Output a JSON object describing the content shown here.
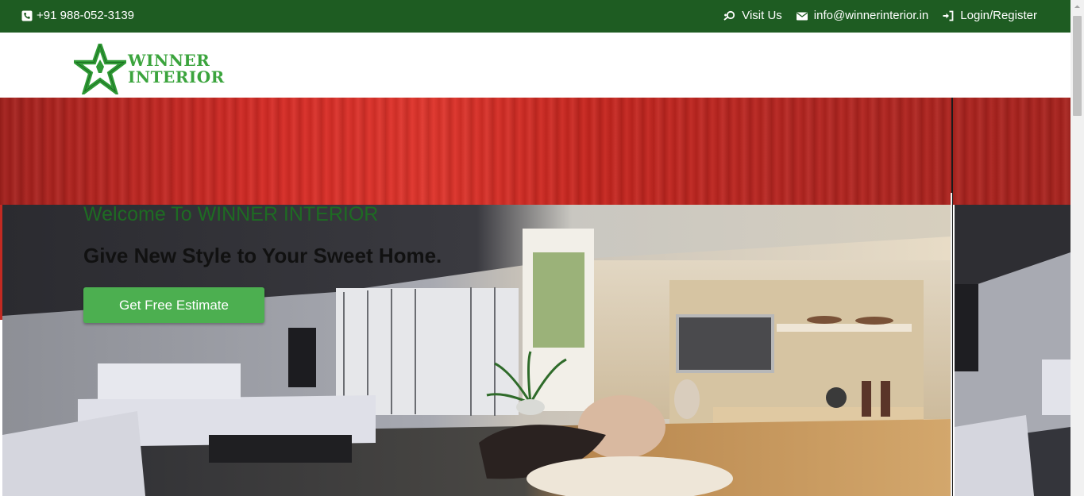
{
  "topbar": {
    "phone": "+91 988-052-3139",
    "visit": "Visit Us",
    "email": "info@winnerinterior.in",
    "login": "Login/Register"
  },
  "logo": {
    "line1": "WINNER",
    "line2": "INTERIOR"
  },
  "hero": {
    "welcome": "Welcome To WINNER INTERIOR",
    "tagline": "Give New Style to Your Sweet Home.",
    "cta": "Get Free Estimate"
  },
  "colors": {
    "topbar": "#1e5c22",
    "logo_green": "#3ba43d",
    "cta_green": "#4caf50",
    "curtain_red": "#d62b25",
    "welcome_green": "#1e6b23"
  },
  "icons": {
    "phone": "phone-icon",
    "visit": "map-marker-icon",
    "email": "envelope-icon",
    "login": "sign-in-icon",
    "logo": "star-logo-icon"
  }
}
